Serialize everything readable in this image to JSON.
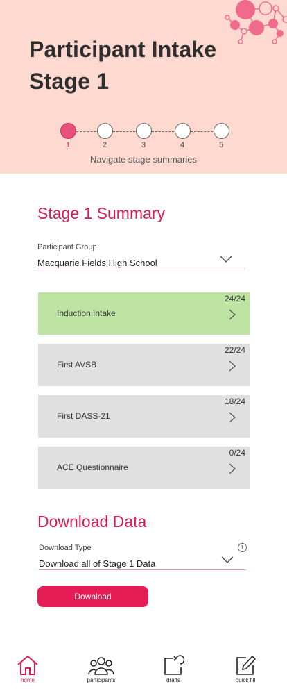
{
  "header": {
    "title_line1": "Participant Intake",
    "title_line2": "Stage 1"
  },
  "stepper": {
    "steps": [
      "1",
      "2",
      "3",
      "4",
      "5"
    ],
    "active_step": 1,
    "caption": "Navigate stage summaries"
  },
  "summary": {
    "title": "Stage 1 Summary",
    "group_label": "Participant Group",
    "group_value": "Macquarie Fields High School",
    "cards": [
      {
        "label": "Induction Intake",
        "count": "24/24",
        "complete": true
      },
      {
        "label": "First AVSB",
        "count": "22/24",
        "complete": false
      },
      {
        "label": "First DASS-21",
        "count": "18/24",
        "complete": false
      },
      {
        "label": "ACE Questionnaire",
        "count": "0/24",
        "complete": false
      }
    ]
  },
  "download": {
    "title": "Download Data",
    "type_label": "Download Type",
    "type_value": "Download all of Stage 1 Data",
    "button_label": "Download"
  },
  "nav": {
    "items": [
      {
        "label": "home",
        "icon": "home-icon",
        "active": true
      },
      {
        "label": "participants",
        "icon": "participants-icon",
        "active": false
      },
      {
        "label": "drafts",
        "icon": "drafts-icon",
        "active": false
      },
      {
        "label": "quick fill",
        "icon": "quick-fill-icon",
        "active": false
      }
    ]
  },
  "colors": {
    "accent": "#d81b55",
    "header_bg": "#fdd9d0",
    "complete_card": "#bde3a2",
    "pending_card": "#e0e0e0"
  }
}
